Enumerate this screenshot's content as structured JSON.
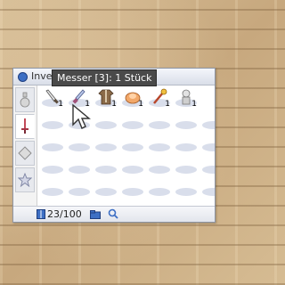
{
  "window": {
    "title": "Inventar",
    "tabs": [
      {
        "name": "item-tab",
        "icon": "potion-icon",
        "active": false
      },
      {
        "name": "equip-tab",
        "icon": "sword-icon",
        "active": true
      },
      {
        "name": "etc-tab",
        "icon": "gem-icon",
        "active": false
      },
      {
        "name": "fav-tab",
        "icon": "star-icon",
        "active": false
      }
    ],
    "items": [
      {
        "icon": "knife-icon",
        "count": "1"
      },
      {
        "icon": "dagger-icon",
        "count": "1"
      },
      {
        "icon": "cotton-shirt-icon",
        "count": "1"
      },
      {
        "icon": "sandals-icon",
        "count": "1"
      },
      {
        "icon": "wand-icon",
        "count": "1"
      },
      {
        "icon": "armor-icon",
        "count": "1"
      }
    ],
    "status": {
      "capacity": "23/100"
    }
  },
  "tooltip": {
    "text": "Messer [3]: 1 Stück"
  },
  "colors": {
    "accent": "#3d6fc4",
    "tooltip_bg": "#4a4a4a"
  }
}
